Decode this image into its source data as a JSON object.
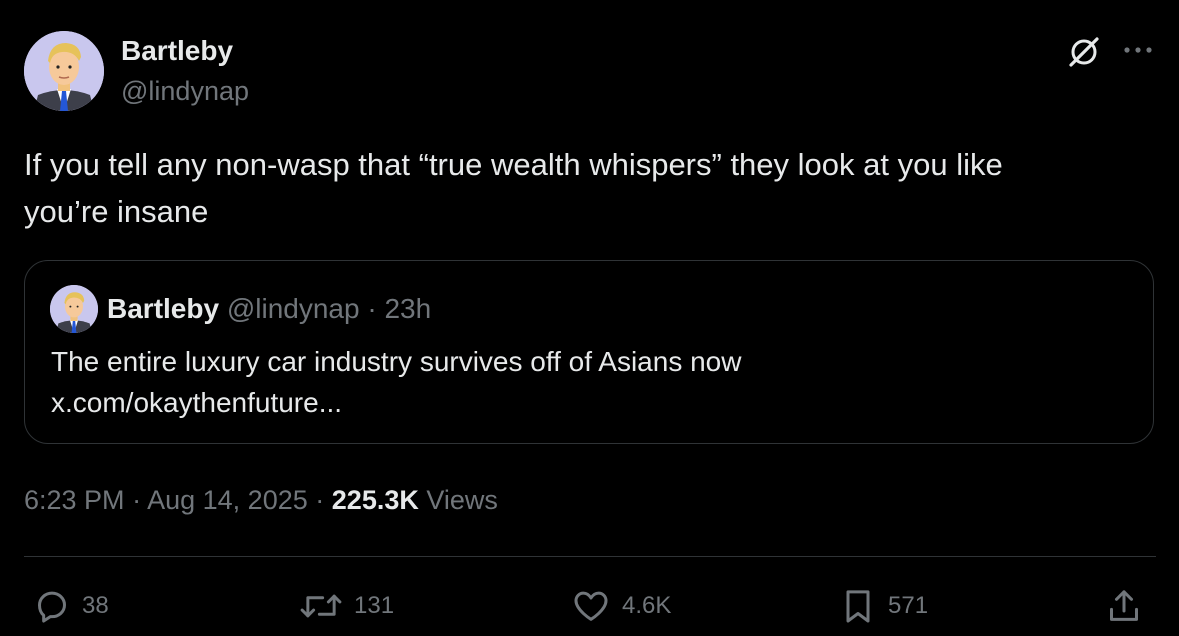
{
  "tweet": {
    "author": {
      "name": "Bartleby",
      "handle": "@lindynap"
    },
    "text_line1": "If you tell any non-wasp that “true wealth whispers” they look at you like",
    "text_line2": "you’re insane",
    "quoted": {
      "name": "Bartleby",
      "handle": "@lindynap",
      "separator": "·",
      "age": "23h",
      "text": "The entire luxury car industry survives off of Asians now",
      "link": "x.com/okaythenfuture..."
    },
    "meta": {
      "time": "6:23 PM",
      "separator": "·",
      "date": "Aug 14, 2025",
      "views_count": "225.3K",
      "views_label": "Views"
    },
    "actions": {
      "replies": "38",
      "reposts": "131",
      "likes": "4.6K",
      "bookmarks": "571"
    }
  },
  "icons": {
    "header": [
      "grok-icon",
      "more-icon"
    ],
    "actions": [
      "reply-icon",
      "repost-icon",
      "like-icon",
      "bookmark-icon",
      "share-icon"
    ]
  },
  "colors": {
    "background": "#000000",
    "text_primary": "#e7e9ea",
    "text_secondary": "#71767b",
    "border": "#2f3336",
    "avatar_bg": "#c9c7ee"
  }
}
